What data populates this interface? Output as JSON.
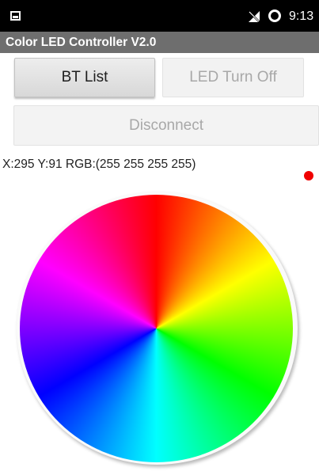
{
  "status_bar": {
    "time": "9:13",
    "icons": [
      "notification-icon",
      "no-signal-icon",
      "circle-status-icon"
    ]
  },
  "app": {
    "title": "Color LED Controller V2.0"
  },
  "buttons": {
    "bt_list": "BT List",
    "led_turn_off": "LED Turn Off",
    "disconnect": "Disconnect"
  },
  "readout": {
    "text": "X:295 Y:91  RGB:(255 255 255 255)"
  },
  "indicator": {
    "color": "#f00000"
  },
  "wheel": {
    "colors": [
      "#ff0000",
      "#ffff00",
      "#00ff00",
      "#00ffff",
      "#0000ff",
      "#ff00ff"
    ]
  },
  "colors": {
    "status_bar": "#000000",
    "title_bar": "#6e6e6e",
    "background": "#ffffff"
  }
}
